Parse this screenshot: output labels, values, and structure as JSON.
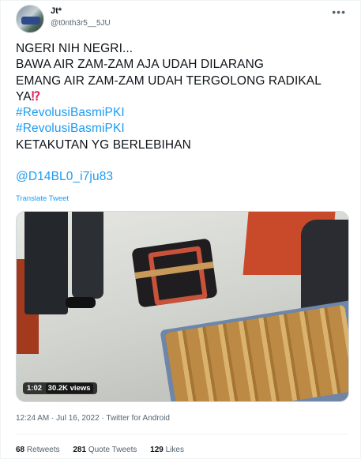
{
  "author": {
    "name": "Jt*",
    "handle": "@t0nth3r5__5JU"
  },
  "tweet": {
    "lines": [
      "NGERI NIH NEGRI...",
      "BAWA AIR ZAM-ZAM AJA UDAH DILARANG",
      "EMANG AIR ZAM-ZAM UDAH TERGOLONG RADIKAL",
      "YA"
    ],
    "emoji": "⁉",
    "hashtags": [
      "#RevolusiBasmiPKI",
      "#RevolusiBasmiPKI"
    ],
    "closing": "KETAKUTAN YG BERLEBIHAN",
    "mention": "@D14BL0_i7ju83",
    "translate_label": "Translate Tweet"
  },
  "video": {
    "duration": "1:02",
    "views": "30.2K views"
  },
  "meta": {
    "time": "12:24 AM",
    "date": "Jul 16, 2022",
    "source": "Twitter for Android",
    "separator": "·"
  },
  "stats": {
    "retweets_count": "68",
    "retweets_label": "Retweets",
    "quotes_count": "281",
    "quotes_label": "Quote Tweets",
    "likes_count": "129",
    "likes_label": "Likes"
  },
  "icons": {
    "more": "more-horizontal-icon"
  },
  "colors": {
    "link": "#1d9bf0",
    "text": "#0f1419",
    "secondary": "#536471",
    "emoji": "#e0245e"
  }
}
